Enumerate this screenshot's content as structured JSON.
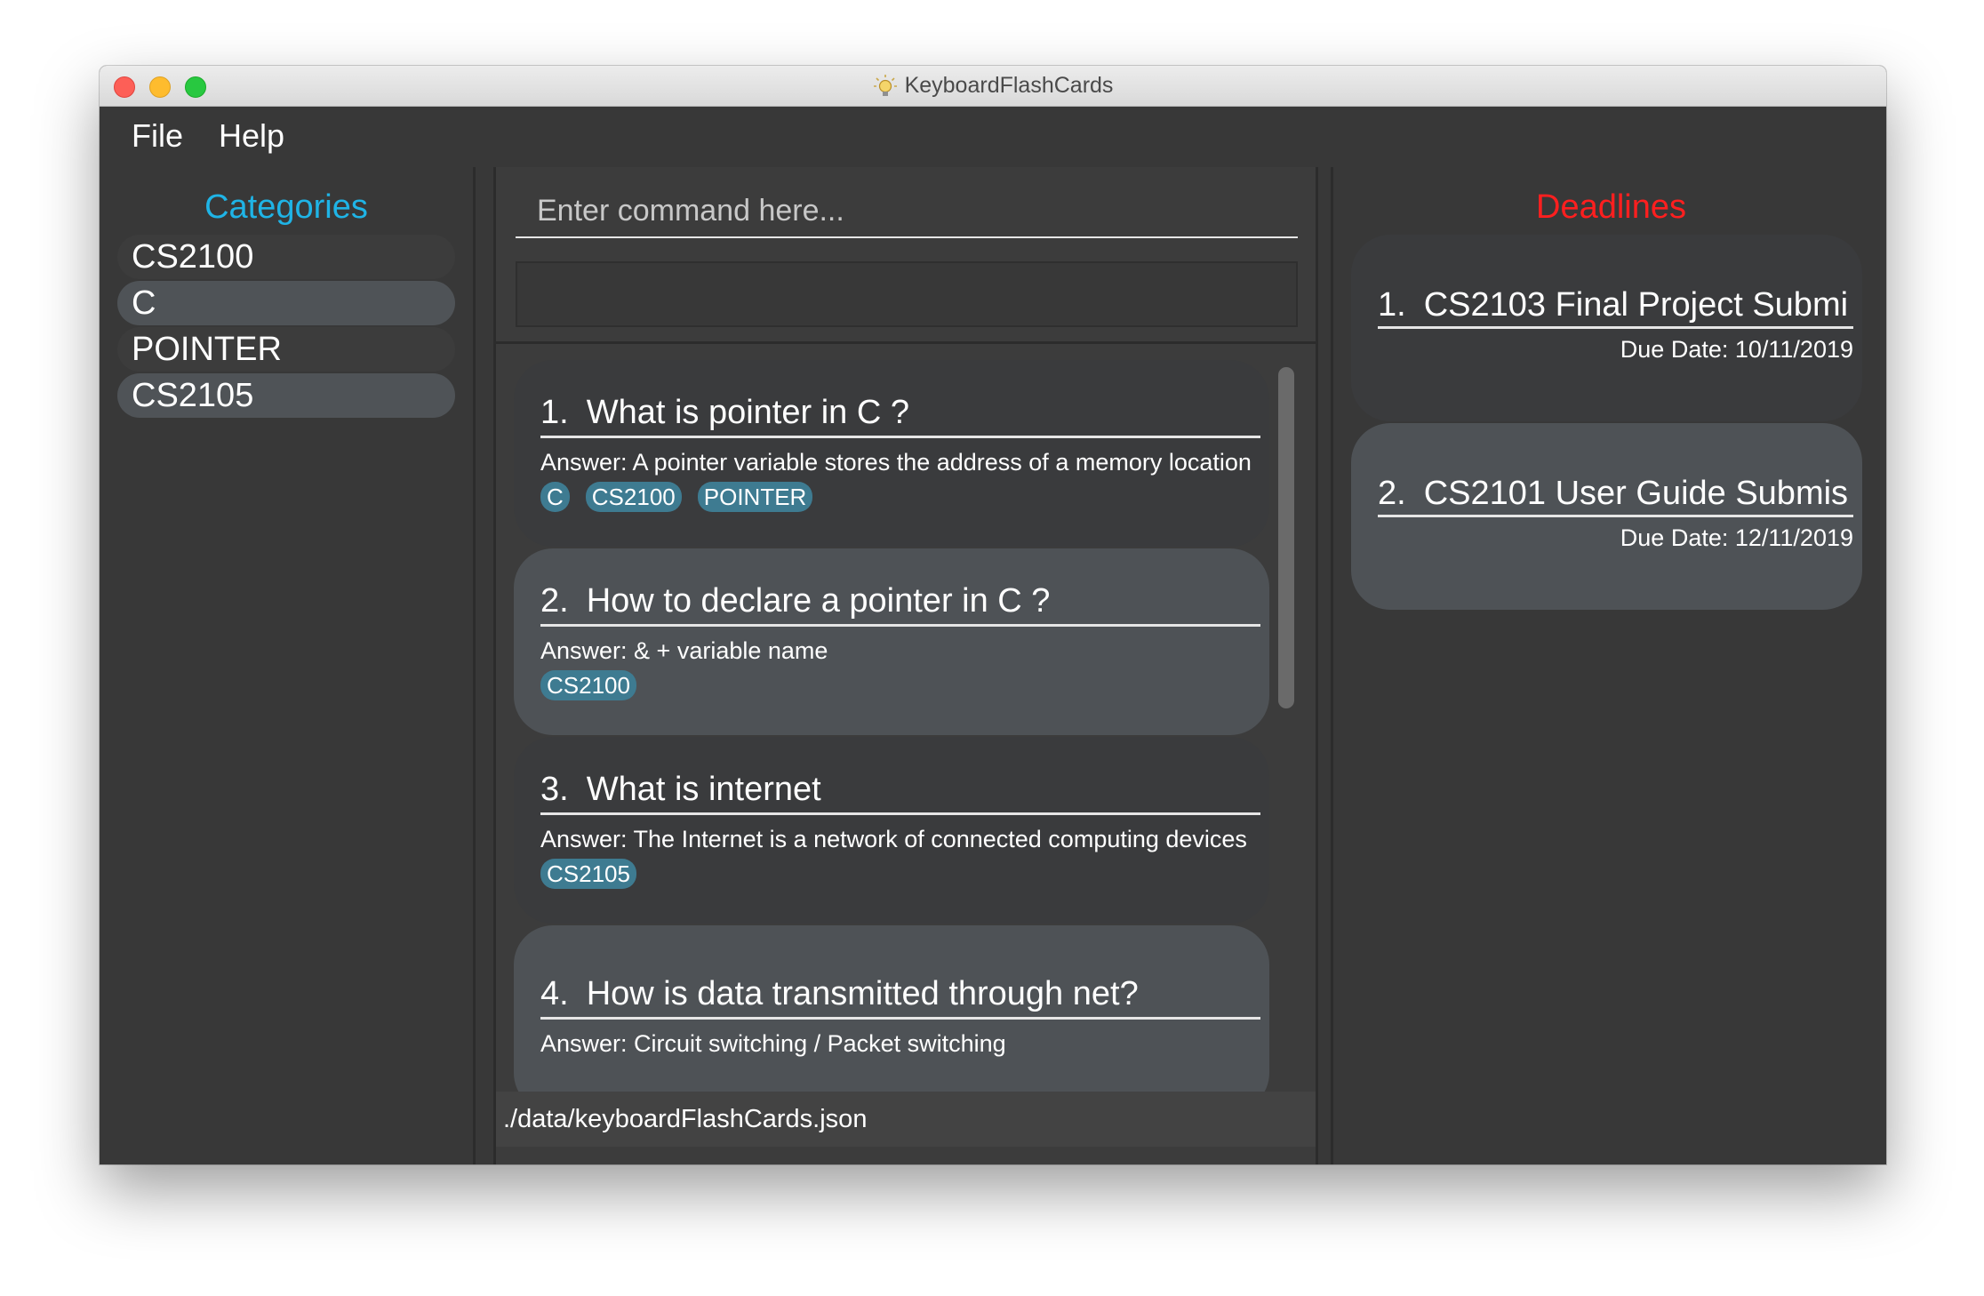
{
  "window": {
    "title": "KeyboardFlashCards"
  },
  "menu": [
    "File",
    "Help"
  ],
  "categories": {
    "header": "Categories",
    "items": [
      "CS2100",
      "C",
      "POINTER",
      "CS2105"
    ]
  },
  "command": {
    "placeholder": "Enter command here...",
    "value": ""
  },
  "flashcards": [
    {
      "index": "1.",
      "question": "What is pointer in C ?",
      "answer": "Answer: A pointer variable stores the address of a memory location",
      "tags": [
        "C",
        "CS2100",
        "POINTER"
      ]
    },
    {
      "index": "2.",
      "question": "How to declare a pointer in C ?",
      "answer": "Answer: & + variable name",
      "tags": [
        "CS2100"
      ]
    },
    {
      "index": "3.",
      "question": "What is internet",
      "answer": "Answer: The Internet is a network of connected computing devices",
      "tags": [
        "CS2105"
      ]
    },
    {
      "index": "4.",
      "question": "How is data transmitted through net?",
      "answer": "Answer: Circuit switching / Packet switching",
      "tags": []
    }
  ],
  "status": {
    "path": "./data/keyboardFlashCards.json"
  },
  "deadlines": {
    "header": "Deadlines",
    "items": [
      {
        "index": "1.",
        "title": "CS2103 Final Project Submi",
        "due": "Due Date: 10/11/2019"
      },
      {
        "index": "2.",
        "title": "CS2101 User Guide Submis",
        "due": "Due Date: 12/11/2019"
      }
    ]
  },
  "colors": {
    "categories_header": "#1fb4e6",
    "deadlines_header": "#ff1f1f",
    "tag_bg": "#3e7b91",
    "background": "#383838"
  }
}
